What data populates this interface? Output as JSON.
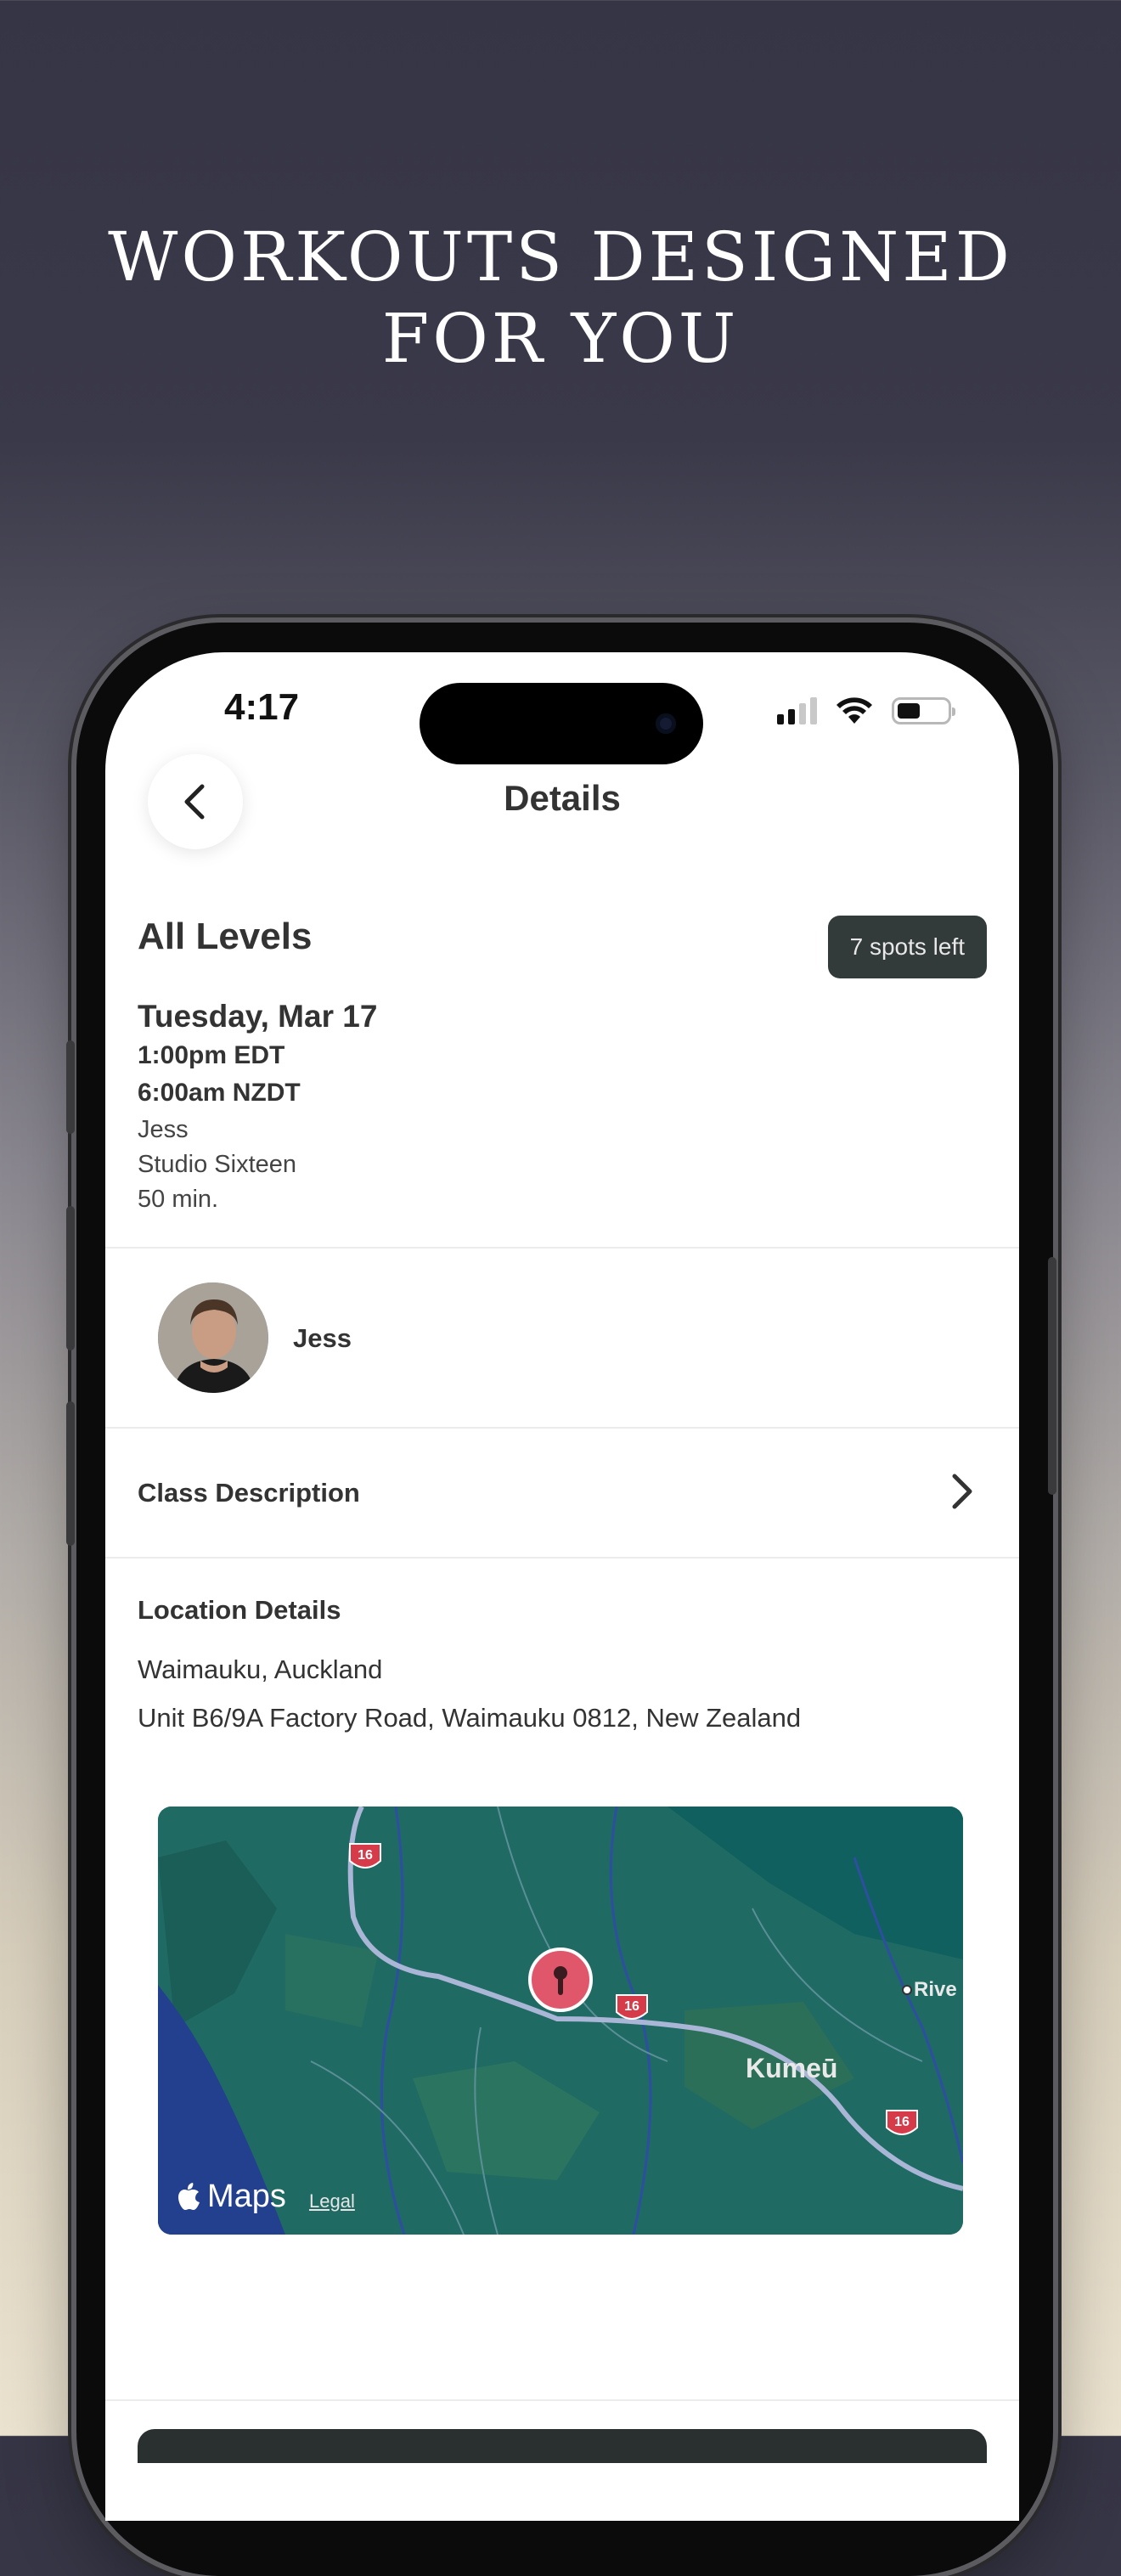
{
  "promo": {
    "headline_line1": "WORKOUTS DESIGNED",
    "headline_line2": "FOR YOU"
  },
  "status_bar": {
    "time": "4:17"
  },
  "nav": {
    "title": "Details",
    "back_icon": "chevron-left-icon"
  },
  "class": {
    "title": "All Levels",
    "spots_left": "7 spots left",
    "date": "Tuesday, Mar 17",
    "time_edt": "1:00pm EDT",
    "time_nzdt": "6:00am NZDT",
    "instructor": "Jess",
    "studio": "Studio Sixteen",
    "duration": "50 min."
  },
  "instructor_card": {
    "name": "Jess"
  },
  "description": {
    "label": "Class Description"
  },
  "location": {
    "heading": "Location Details",
    "area": "Waimauku, Auckland",
    "address": "Unit B6/9A Factory Road, Waimauku 0812, New Zealand"
  },
  "map": {
    "brand": "Maps",
    "legal": "Legal",
    "place_kumeu": "Kumeū",
    "place_rive": "Rive",
    "route_shield": "16"
  },
  "colors": {
    "accent_dark": "#333a3a",
    "map_green": "#1f6a63",
    "pin_red": "#e0566a",
    "route_shield_red": "#d63b4a"
  }
}
